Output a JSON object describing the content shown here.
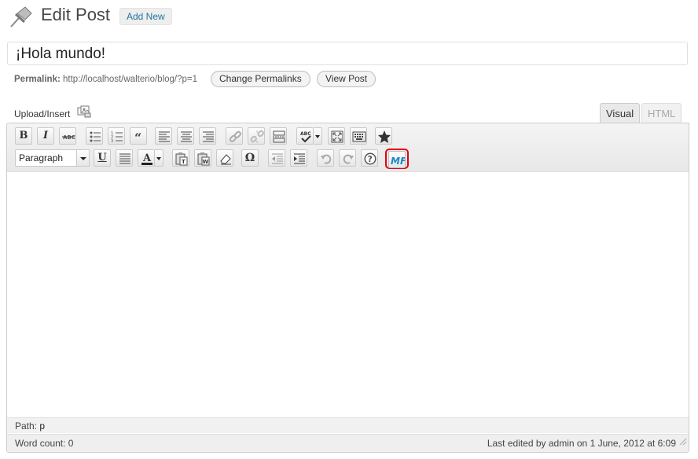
{
  "header": {
    "title": "Edit Post",
    "add_new_label": "Add New"
  },
  "post": {
    "title": "¡Hola mundo!"
  },
  "permalink": {
    "label": "Permalink:",
    "url": "http://localhost/walterio/blog/?p=1",
    "change_label": "Change Permalinks",
    "view_label": "View Post"
  },
  "upload": {
    "label": "Upload/Insert"
  },
  "tabs": {
    "visual": "Visual",
    "html": "HTML"
  },
  "toolbar": {
    "format_value": "Paragraph",
    "mf_label": "MF",
    "omega": "Ω",
    "accent_color": "#e8000d"
  },
  "path": {
    "label": "Path:",
    "value": "p"
  },
  "status": {
    "word_count": "Word count: 0",
    "last_edited": "Last edited by admin on 1 June, 2012 at 6:09"
  }
}
